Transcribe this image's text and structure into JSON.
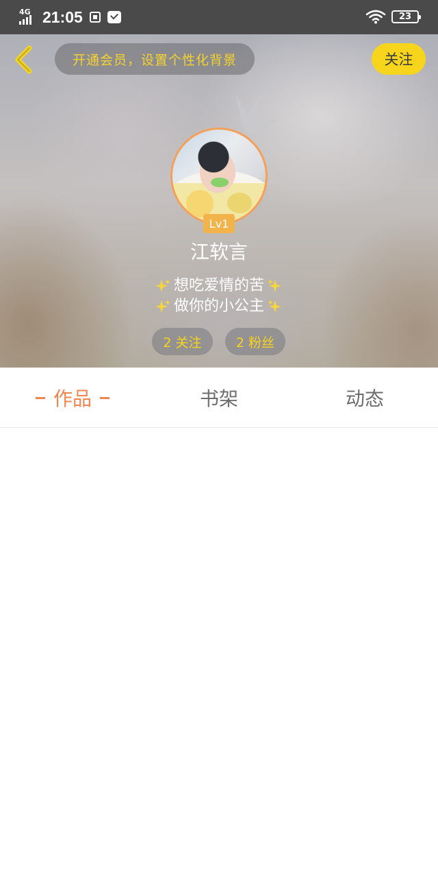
{
  "status_bar": {
    "network": "4G",
    "time": "21:05",
    "battery": "23",
    "icons": [
      "signal-icon",
      "screenshot-icon",
      "message-icon",
      "wifi-icon",
      "battery-icon"
    ]
  },
  "header": {
    "back_icon": "chevron-left-icon",
    "vip_banner": "开通会员，设置个性化背景",
    "follow_button": "关注",
    "crown_icon": "crown-icon",
    "level": "Lv1",
    "username": "江软言",
    "bio": [
      "想吃爱情的苦",
      "做你的小公主"
    ],
    "sparkle_icon": "sparkle-icon",
    "stats": {
      "follows": "2 关注",
      "fans": "2 粉丝"
    }
  },
  "tabs": {
    "items": [
      "作品",
      "书架",
      "动态"
    ],
    "active": "作品"
  },
  "colors": {
    "accent": "#f0864d",
    "yellow": "#f7d51d",
    "status_bar": "#4a4a4a",
    "tab_text": "#6d6d6d"
  }
}
